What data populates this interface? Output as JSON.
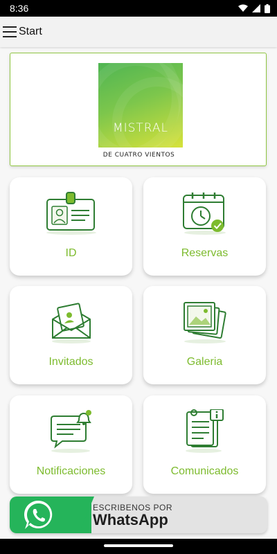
{
  "status_bar": {
    "time": "8:36",
    "icons": [
      "wifi-icon",
      "signal-icon",
      "battery-icon"
    ]
  },
  "app_bar": {
    "title": "Start",
    "icon": "menu-icon"
  },
  "banner": {
    "logo_title": "MISTRAL",
    "logo_subtitle": "DE CUATRO VIENTOS"
  },
  "tiles": [
    {
      "label": "ID",
      "icon": "id-card-icon"
    },
    {
      "label": "Reservas",
      "icon": "calendar-clock-icon"
    },
    {
      "label": "Invitados",
      "icon": "invitation-envelope-icon"
    },
    {
      "label": "Galeria",
      "icon": "gallery-icon"
    },
    {
      "label": "Notificaciones",
      "icon": "chat-bell-icon"
    },
    {
      "label": "Comunicados",
      "icon": "clipboard-info-icon"
    }
  ],
  "whatsapp": {
    "small_text": "ESCRIBENOS POR",
    "big_text": "WhatsApp",
    "icon": "whatsapp-icon"
  },
  "colors": {
    "accent_green": "#7dbb2e",
    "icon_green": "#2e7d32",
    "whatsapp_green": "#25b45a"
  }
}
